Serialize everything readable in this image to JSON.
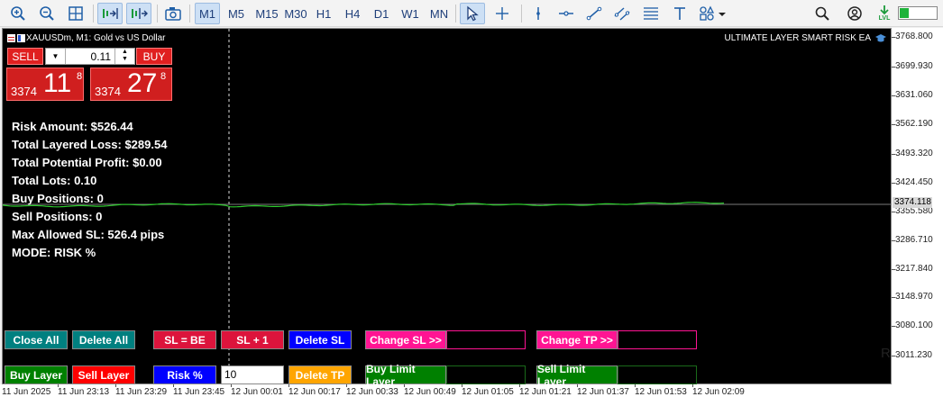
{
  "toolbar": {
    "timeframes": [
      "M1",
      "M5",
      "M15",
      "M30",
      "H1",
      "H4",
      "D1",
      "W1",
      "MN"
    ],
    "active_timeframe": "M1",
    "lvl_label": "LVL",
    "icons": [
      "zoom-in-icon",
      "zoom-out-icon",
      "grid-icon",
      "autoscroll-icon",
      "chart-shift-icon",
      "screenshot-icon",
      "cursor-icon",
      "crosshair-icon",
      "vertical-line-icon",
      "horizontal-line-icon",
      "trendline-icon",
      "channel-icon",
      "fibonacci-icon",
      "text-icon",
      "shapes-icon",
      "search-icon",
      "account-icon",
      "signal-icon"
    ]
  },
  "chart": {
    "symbol_title": "XAUUSDm, M1:  Gold vs US Dollar",
    "ea_name": "ULTIMATE LAYER SMART RISK EA",
    "current_price": "3374.118",
    "price_labels": [
      "3768.800",
      "3699.930",
      "3631.060",
      "3562.190",
      "3493.320",
      "3424.450",
      "3355.580",
      "3286.710",
      "3217.840",
      "3148.970",
      "3080.100",
      "3011.230"
    ],
    "time_labels": [
      "11 Jun 2025",
      "11 Jun 23:13",
      "11 Jun 23:29",
      "11 Jun 23:45",
      "12 Jun 00:01",
      "12 Jun 00:17",
      "12 Jun 00:33",
      "12 Jun 00:49",
      "12 Jun 01:05",
      "12 Jun 01:21",
      "12 Jun 01:37",
      "12 Jun 01:53",
      "12 Jun 02:09"
    ],
    "r_marker": "R",
    "price_line_color": "#2ecc2e"
  },
  "one_click": {
    "sell_label": "SELL",
    "buy_label": "BUY",
    "lot_value": "0.11",
    "bid": {
      "prefix": "3374",
      "big": "11",
      "sup": "8"
    },
    "ask": {
      "prefix": "3374",
      "big": "27",
      "sup": "8"
    }
  },
  "info": {
    "risk_amount": "Risk Amount: $526.44",
    "total_layered_loss": "Total Layered Loss: $289.54",
    "total_potential_profit": "Total Potential Profit: $0.00",
    "total_lots": "Total Lots: 0.10",
    "buy_positions": "Buy Positions: 0",
    "sell_positions": "Sell Positions: 0",
    "max_allowed_sl": "Max Allowed SL: 526.4 pips",
    "mode": "MODE: RISK %"
  },
  "buttons": {
    "close_all": "Close All",
    "delete_all": "Delete All",
    "sl_be": "SL = BE",
    "sl_plus_one": "SL + 1",
    "delete_sl": "Delete SL",
    "change_sl": "Change SL >>",
    "change_tp": "Change TP >>",
    "buy_layer": "Buy Layer",
    "sell_layer": "Sell Layer",
    "risk_pct": "Risk %",
    "risk_value": "10",
    "delete_tp": "Delete TP",
    "buy_limit_layer": "Buy Limit Layer",
    "sell_limit_layer": "Sell Limit Layer"
  },
  "colors": {
    "teal": "#008080",
    "crimson": "#dc143c",
    "blue": "#0000ff",
    "pink": "#ff1493",
    "green": "#008000",
    "red": "#ff0000",
    "orange": "#ffa500"
  }
}
